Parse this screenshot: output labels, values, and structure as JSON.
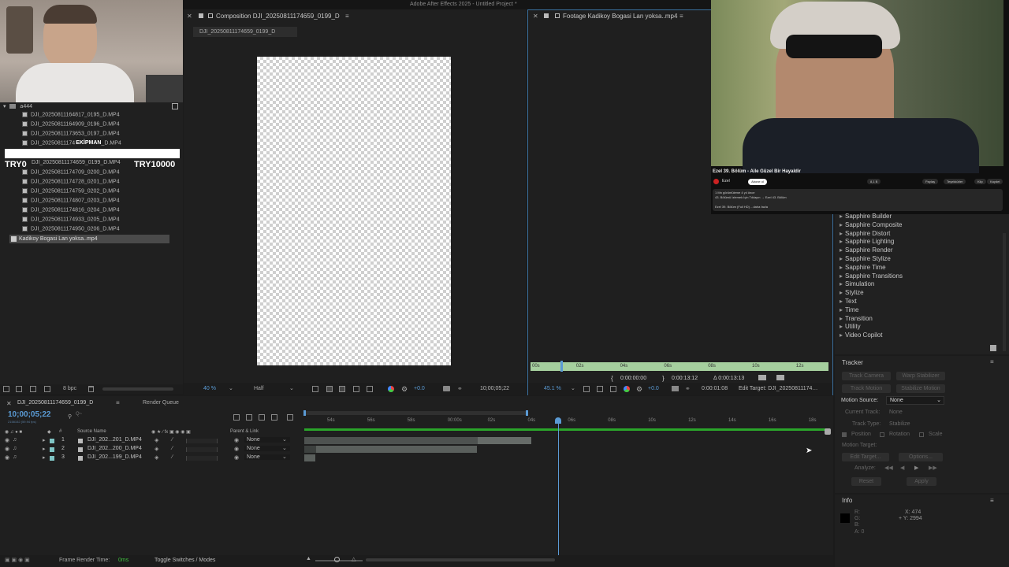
{
  "app": {
    "title": "Adobe After Effects 2025 - Untitled Project *"
  },
  "project": {
    "folder": "a444",
    "files": [
      "DJI_20250811164817_0195_D.MP4",
      "DJI_20250811164909_0196_D.MP4",
      "DJI_20250811173653_0197_D.MP4",
      "DJI_20250811174",
      "DJI_20250811174659_0199_D.MP4",
      "DJI_20250811174709_0200_D.MP4",
      "DJI_20250811174728_0201_D.MP4",
      "DJI_20250811174759_0202_D.MP4",
      "DJI_20250811174807_0203_D.MP4",
      "DJI_20250811174816_0204_D.MP4",
      "DJI_20250811174933_0205_D.MP4",
      "DJI_20250811174950_0206_D.MP4"
    ],
    "file_suffix_partial": "_D.MP4",
    "selected_footage": "Kadikoy Bogasi Lan yoksa..mp4",
    "bpc": "8 bpc",
    "overlay": {
      "left": "TRY0",
      "center": "EKİPMAN",
      "right": "TRY10000"
    }
  },
  "composition": {
    "tab": "Composition DJI_20250811174659_0199_D",
    "sub_tab": "DJI_20250811174659_0199_D",
    "zoom": "40 %",
    "resolution": "Half",
    "exposure": "+0.0",
    "timecode": "10;00;05;22"
  },
  "footage": {
    "tab": "Footage Kadikoy Bogasi Lan yoksa..mp4",
    "ruler": [
      "00s",
      "02s",
      "04s",
      "06s",
      "08s",
      "10s",
      "12s"
    ],
    "in_point": "0:00:00:00",
    "out_point": "0:00:13:12",
    "duration": "Δ 0:00:13:13",
    "zoom": "45.1 %",
    "exposure": "+0.0",
    "timecode": "0:00:01:08",
    "edit_target": "Edit Target: DJI_20250811174…"
  },
  "video_overlay": {
    "title": "Ezel 39. Bölüm - Aile Güzel Bir Hayaldir",
    "channel": "Ezel",
    "subscribe": "Abone ol",
    "desc1": "1 Mn görüntüleme  4 yıl önce",
    "desc2": "43. Bölümü İzlemek İçin Tıklayın → Ezel 43. Bölüm",
    "desc3": "Ezel 39. Bölüm (Full HD)   ...daha fazla",
    "actions": [
      "8,1 B",
      "Paylaş",
      "Teşekkürler",
      "Klip",
      "Kaydet"
    ]
  },
  "effects": {
    "items": [
      "Sapphire Builder",
      "Sapphire Composite",
      "Sapphire Distort",
      "Sapphire Lighting",
      "Sapphire Render",
      "Sapphire Stylize",
      "Sapphire Time",
      "Sapphire Transitions",
      "Simulation",
      "Stylize",
      "Text",
      "Time",
      "Transition",
      "Utility",
      "Video Copilot"
    ]
  },
  "tracker": {
    "title": "Tracker",
    "track_camera": "Track Camera",
    "warp_stabilizer": "Warp Stabilizer",
    "track_motion": "Track Motion",
    "stabilize_motion": "Stabilize Motion",
    "motion_source_label": "Motion Source:",
    "motion_source_value": "None",
    "current_track_label": "Current Track:",
    "current_track_value": "None",
    "track_type_label": "Track Type:",
    "track_type_value": "Stabilize",
    "position": "Position",
    "rotation": "Rotation",
    "scale": "Scale",
    "motion_target": "Motion Target:",
    "edit_target": "Edit Target...",
    "options": "Options...",
    "analyze": "Analyze:",
    "reset": "Reset",
    "apply": "Apply"
  },
  "info": {
    "title": "Info",
    "r": "R:",
    "g": "G:",
    "b": "B:",
    "a": "A: 0",
    "x": "X: 474",
    "y": "+ Y: 2994"
  },
  "timeline": {
    "tab": "DJI_20250811174659_0199_D",
    "render_queue": "Render Queue",
    "timecode": "10;00;05;22",
    "fps": "2158152 (59.94 fps)",
    "search_placeholder": "Q~",
    "col_source": "Source Name",
    "col_parent": "Parent & Link",
    "layers": [
      {
        "num": "1",
        "name": "DJI_202...201_D.MP4",
        "parent": "None"
      },
      {
        "num": "2",
        "name": "DJI_202...200_D.MP4",
        "parent": "None"
      },
      {
        "num": "3",
        "name": "DJI_202...199_D.MP4",
        "parent": "None"
      }
    ],
    "ruler": [
      "54s",
      "56s",
      "58s",
      "00:00s",
      "02s",
      "04s",
      "06s",
      "08s",
      "10s",
      "12s",
      "14s",
      "16s",
      "18s"
    ],
    "frame_render_label": "Frame Render Time:",
    "frame_render_value": "0ms",
    "toggle": "Toggle Switches / Modes"
  }
}
